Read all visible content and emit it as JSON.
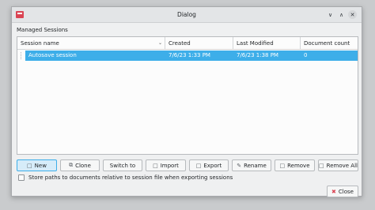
{
  "window": {
    "title": "Dialog"
  },
  "group_label": "Managed Sessions",
  "table": {
    "columns": [
      "Session name",
      "Created",
      "Last Modified",
      "Document count"
    ],
    "rows": [
      {
        "name": "Autosave session",
        "created": "7/6/23 1:33 PM",
        "modified": "7/6/23 1:38 PM",
        "count": "0",
        "selected": true
      }
    ]
  },
  "buttons": {
    "new": "New",
    "clone": "Clone",
    "switch": "Switch to",
    "import": "Import",
    "export": "Export",
    "rename": "Rename",
    "remove": "Remove",
    "remove_all": "Remove All"
  },
  "checkbox_label": "Store paths to documents relative to session file when exporting sessions",
  "checkbox_checked": false,
  "close_label": "Close",
  "colors": {
    "selection": "#3daee9",
    "brand": "#da4453"
  }
}
